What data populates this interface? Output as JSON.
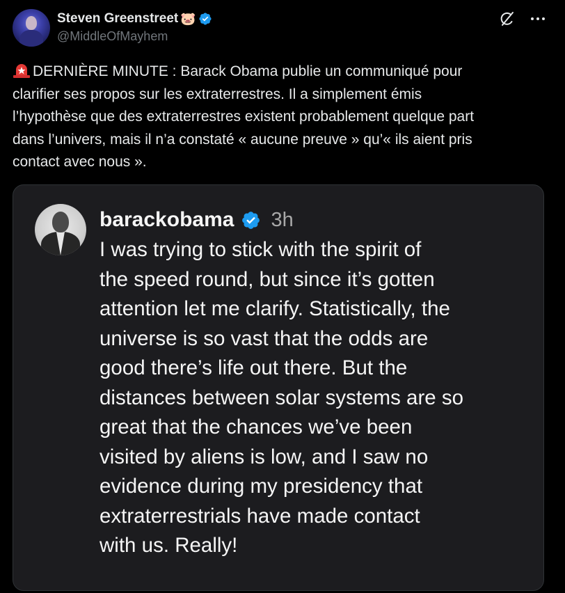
{
  "tweet": {
    "author": {
      "display_name": "Steven Greenstreet",
      "name_emoji": "🐷",
      "handle": "@MiddleOfMayhem",
      "verified": true,
      "avatar_icon": "profile-photo"
    },
    "actions": {
      "grok_icon": "grok-icon",
      "more_label": "···"
    },
    "text_emoji": "siren-icon",
    "text": "DERNIÈRE MINUTE : Barack Obama publie un communiqué pour\nclarifier ses propos sur les extraterrestres. Il a simplement émis\nl’hypothèse que des extraterrestres existent probablement quelque part\ndans l’univers, mais il n’a constaté « aucune preuve » qu’« ils aient pris\ncontact avec nous »."
  },
  "embedded_post": {
    "username": "barackobama",
    "verified": true,
    "time": "3h",
    "avatar_icon": "profile-photo",
    "text": "I was trying to stick with the spirit of\nthe speed round, but since it’s gotten\nattention let me clarify. Statistically, the\nuniverse is so vast that the odds are\ngood there’s life out there. But the\ndistances between solar systems are so\ngreat that the chances we’ve been\nvisited by aliens is low, and I saw no\nevidence during my presidency that\nextraterrestrials have made contact\nwith us. Really!"
  },
  "colors": {
    "background": "#000000",
    "text_primary": "#e7e9ea",
    "text_secondary": "#71767b",
    "verified_blue": "#1d9bf0",
    "card_background": "#1c1c1f",
    "siren_red": "#e0245e"
  }
}
